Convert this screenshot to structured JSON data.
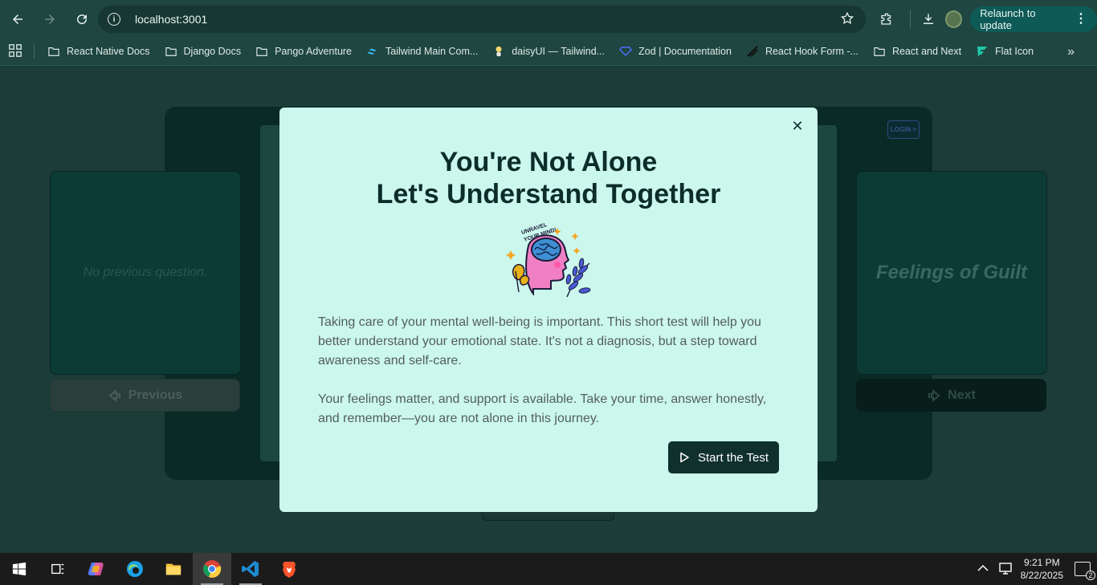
{
  "browser": {
    "url": "localhost:3001",
    "relaunch_label": "Relaunch to update"
  },
  "bookmarks": [
    {
      "label": "React Native Docs",
      "icon": "folder-icon"
    },
    {
      "label": "Django Docs",
      "icon": "folder-icon"
    },
    {
      "label": "Pango Adventure",
      "icon": "folder-icon"
    },
    {
      "label": "Tailwind Main Com...",
      "icon": "tailwind-icon"
    },
    {
      "label": "daisyUI — Tailwind...",
      "icon": "daisyui-icon"
    },
    {
      "label": "Zod | Documentation",
      "icon": "zod-icon"
    },
    {
      "label": "React Hook Form -...",
      "icon": "react-hook-form-icon"
    },
    {
      "label": "React and Next",
      "icon": "folder-icon"
    },
    {
      "label": "Flat Icon",
      "icon": "flaticon-icon"
    }
  ],
  "app": {
    "login_label": "LOGIN >",
    "prev_card_text": "No previous question.",
    "next_card_text": "Feelings of Guilt",
    "prev_button": "Previous",
    "next_button": "Next"
  },
  "modal": {
    "title_line1": "You're Not Alone",
    "title_line2": "Let's Understand Together",
    "illustration_text": "UNRAVEL YOUR MIND!",
    "paragraph1": "Taking care of your mental well-being is important. This short test will help you better understand your emotional state. It's not a diagnosis, but a step toward awareness and self-care.",
    "paragraph2": "Your feelings matter, and support is available. Take your time, answer honestly, and remember—you are not alone in this journey.",
    "start_button": "Start the Test"
  },
  "taskbar": {
    "time": "9:21 PM",
    "date": "8/22/2025",
    "notification_count": "2"
  }
}
